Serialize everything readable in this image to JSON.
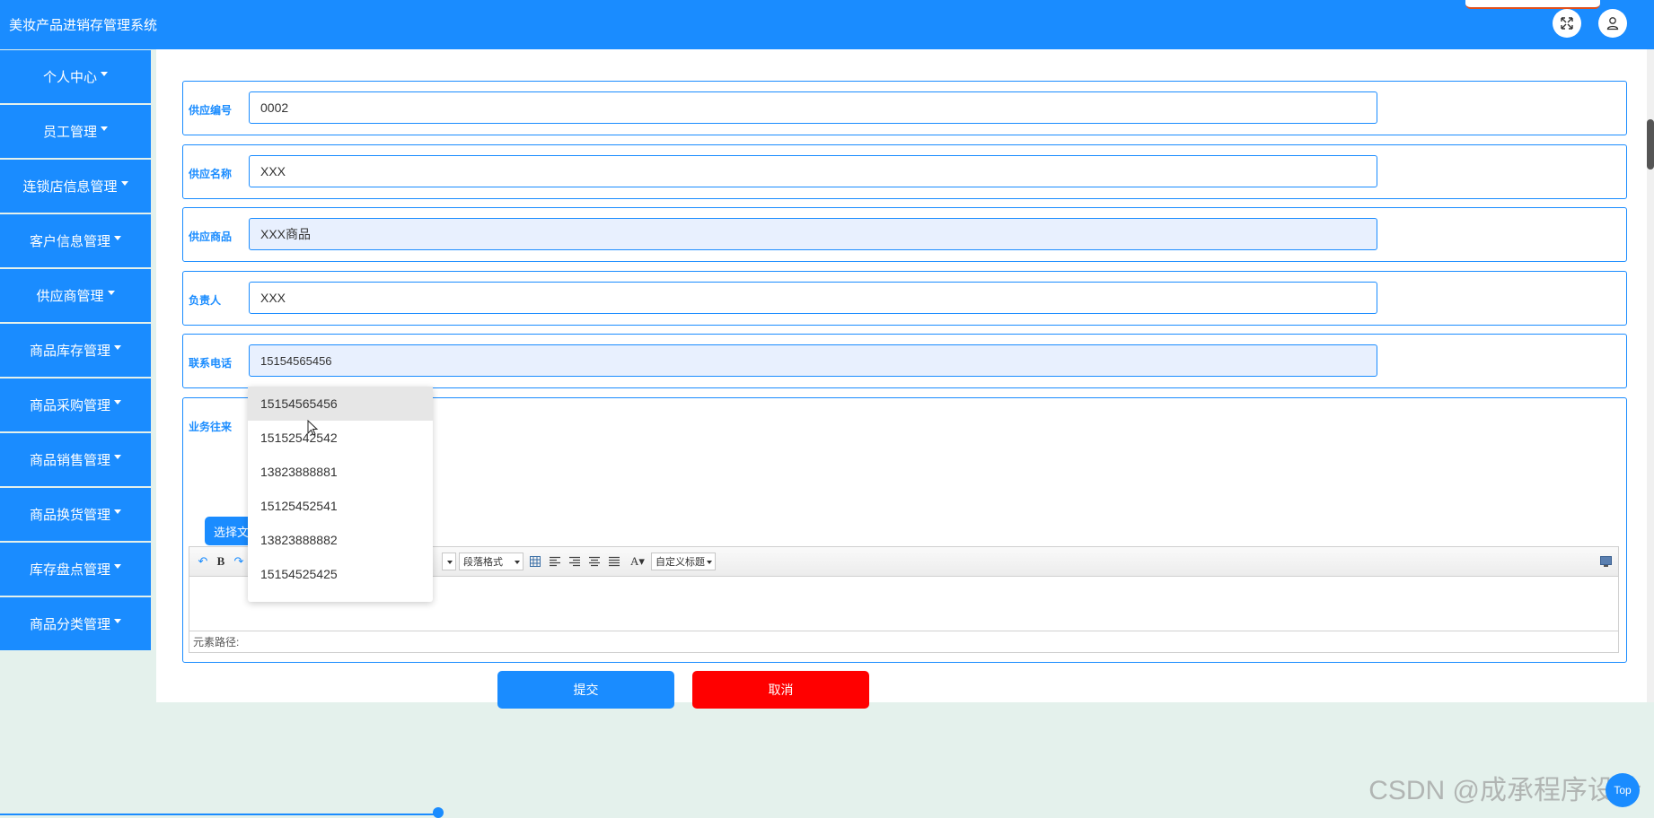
{
  "header": {
    "title": "美妆产品进销存管理系统"
  },
  "sidebar": {
    "items": [
      {
        "label": "个人中心"
      },
      {
        "label": "员工管理"
      },
      {
        "label": "连锁店信息管理"
      },
      {
        "label": "客户信息管理"
      },
      {
        "label": "供应商管理"
      },
      {
        "label": "商品库存管理"
      },
      {
        "label": "商品采购管理"
      },
      {
        "label": "商品销售管理"
      },
      {
        "label": "商品换货管理"
      },
      {
        "label": "库存盘点管理"
      },
      {
        "label": "商品分类管理"
      }
    ]
  },
  "form": {
    "supply_id": {
      "label": "供应编号",
      "value": "0002"
    },
    "supply_name": {
      "label": "供应名称",
      "value": "XXX"
    },
    "supply_goods": {
      "label": "供应商品",
      "value": "XXX商品"
    },
    "contact_person": {
      "label": "负责人",
      "value": "XXX"
    },
    "phone": {
      "label": "联系电话",
      "value": "15154565456"
    },
    "business": {
      "label": "业务往来",
      "choose_file_label": "选择文"
    }
  },
  "autocomplete": {
    "options": [
      "15154565456",
      "15152542542",
      "13823888881",
      "15125452541",
      "13823888882",
      "15154525425"
    ]
  },
  "editor": {
    "paragraph_select": "段落格式",
    "custom_title_select": "自定义标题",
    "element_path_label": "元素路径:"
  },
  "actions": {
    "submit_label": "提交",
    "cancel_label": "取消"
  },
  "watermark": "CSDN @成承程序设计",
  "top_button": "Top",
  "colors": {
    "primary": "#1a8cff",
    "danger": "#ff0000",
    "background": "#e4f1ec"
  }
}
